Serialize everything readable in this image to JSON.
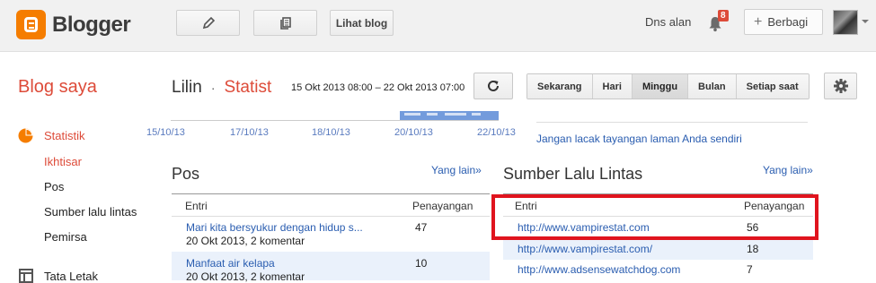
{
  "topbar": {
    "brand": "Blogger",
    "view_blog_label": "Lihat blog",
    "user_name": "Dns alan",
    "notification_count": "8",
    "share_label": "Berbagi",
    "colors": {
      "brand": "#f57d00",
      "badge": "#dd4b39"
    }
  },
  "header": {
    "my_blogs": "Blog saya",
    "blog_name": "Lilin",
    "separator": "·",
    "section": "Statist",
    "date_range": "15 Okt 2013 08:00 – 22 Okt 2013 07:00",
    "ranges": [
      "Sekarang",
      "Hari",
      "Minggu",
      "Bulan",
      "Setiap saat"
    ],
    "active_range": "Minggu"
  },
  "sidebar": {
    "title": "Statistik",
    "items": [
      "Ikhtisar",
      "Pos",
      "Sumber lalu lintas",
      "Pemirsa"
    ],
    "next_section": "Tata Letak"
  },
  "chart": {
    "x_ticks": [
      "15/10/13",
      "17/10/13",
      "18/10/13",
      "20/10/13",
      "22/10/13"
    ]
  },
  "tracking_link": "Jangan lacak tayangan laman Anda sendiri",
  "posts": {
    "title": "Pos",
    "more": "Yang lain»",
    "col_entry": "Entri",
    "col_views": "Penayangan",
    "rows": [
      {
        "title": "Mari kita bersyukur dengan hidup s...",
        "meta": "20 Okt 2013, 2 komentar",
        "views": "47"
      },
      {
        "title": "Manfaat air kelapa",
        "meta": "20 Okt 2013, 2 komentar",
        "views": "10"
      }
    ]
  },
  "traffic": {
    "title": "Sumber Lalu Lintas",
    "more": "Yang lain»",
    "col_entry": "Entri",
    "col_views": "Penayangan",
    "rows": [
      {
        "url": "http://www.vampirestat.com",
        "views": "56"
      },
      {
        "url": "http://www.vampirestat.com/",
        "views": "18"
      },
      {
        "url": "http://www.adsensewatchdog.com",
        "views": "7"
      }
    ]
  }
}
